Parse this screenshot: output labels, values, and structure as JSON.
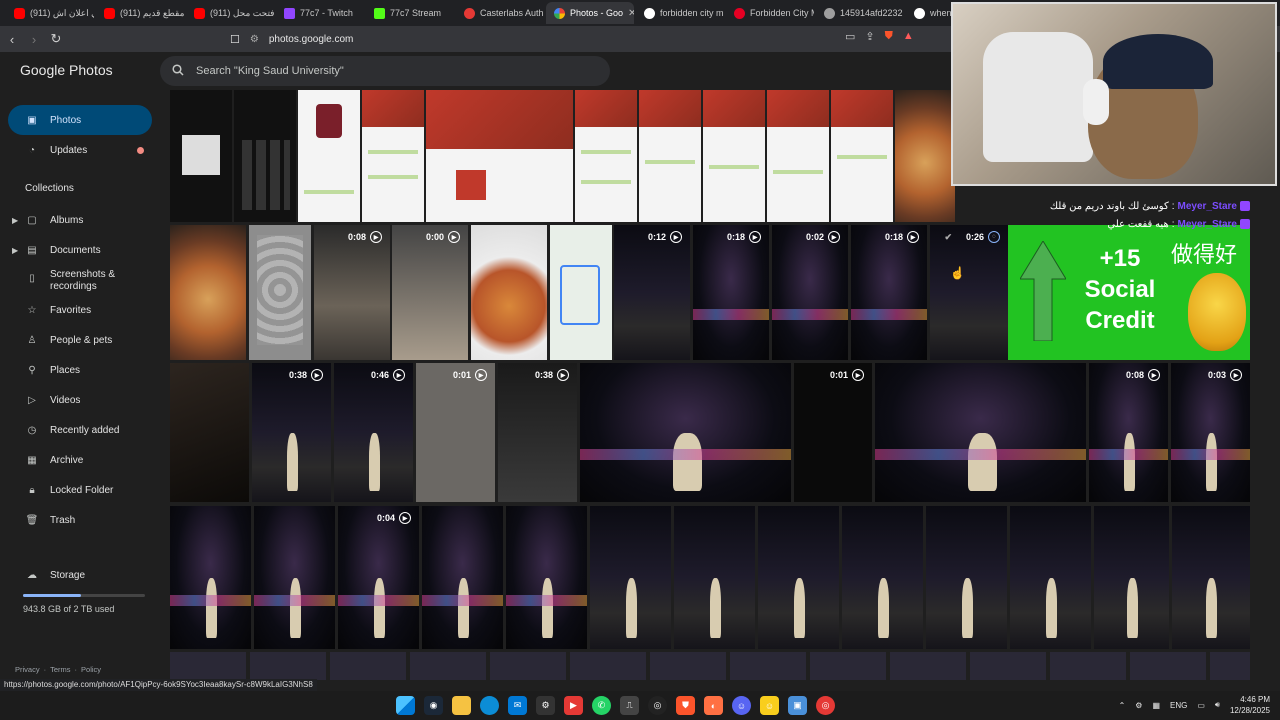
{
  "browser": {
    "tabs": [
      {
        "label": "(911) اي اعلان اش",
        "color": "#ff0000"
      },
      {
        "label": "(911) مقطع قديم",
        "color": "#ff0000"
      },
      {
        "label": "(911) فتحت محل",
        "color": "#ff0000"
      },
      {
        "label": "77c7 - Twitch",
        "color": "#9146ff"
      },
      {
        "label": "77c7 Stream",
        "color": "#53fc18"
      },
      {
        "label": "Casterlabs Auth",
        "color": "#e53935"
      },
      {
        "label": "Photos - Goo",
        "color": "#fbbc04",
        "active": true
      },
      {
        "label": "forbidden city m",
        "color": "#ffffff"
      },
      {
        "label": "Forbidden City M",
        "color": "#e60023"
      },
      {
        "label": "145914afd2232",
        "color": "#9e9e9e"
      },
      {
        "label": "when did the",
        "color": "#ffffff"
      }
    ],
    "url": "photos.google.com",
    "status_url": "https://photos.google.com/photo/AF1QipPcy-6ok9SYoc3Ieaa8kaySr-c8W9kLaIG3NhS8"
  },
  "app": {
    "logo_google": "Google",
    "logo_photos": "Photos",
    "search_placeholder": "Search \"King Saud University\""
  },
  "sidebar": {
    "primary": [
      {
        "label": "Photos",
        "icon": "photo-icon"
      },
      {
        "label": "Updates",
        "icon": "updates-icon"
      }
    ],
    "collections_title": "Collections",
    "collections": [
      {
        "label": "Albums",
        "icon": "album-icon",
        "expand": true
      },
      {
        "label": "Documents",
        "icon": "document-icon",
        "expand": true
      },
      {
        "label": "Screenshots &",
        "label2": "recordings",
        "icon": "screenshot-icon"
      },
      {
        "label": "Favorites",
        "icon": "star-icon"
      },
      {
        "label": "People & pets",
        "icon": "person-icon"
      },
      {
        "label": "Places",
        "icon": "place-icon"
      },
      {
        "label": "Videos",
        "icon": "video-icon"
      },
      {
        "label": "Recently added",
        "icon": "history-icon"
      },
      {
        "label": "Archive",
        "icon": "archive-icon"
      },
      {
        "label": "Locked Folder",
        "icon": "lock-icon"
      },
      {
        "label": "Trash",
        "icon": "trash-icon"
      }
    ],
    "storage_label": "Storage",
    "storage_text": "943.8 GB of 2 TB used",
    "storage_fraction": 0.4719,
    "footer": [
      "Privacy",
      "·",
      "Terms",
      "·",
      "Policy"
    ]
  },
  "videos": {
    "r2": [
      "0:08",
      "0:00",
      "0:12",
      "0:18",
      "0:02",
      "0:18",
      "0:26"
    ],
    "r3": [
      "0:38",
      "0:46",
      "0:01",
      "0:38",
      "0:01",
      "0:08",
      "0:03"
    ],
    "r4": [
      "0:04"
    ]
  },
  "overlay": {
    "credit_line1": "+15",
    "credit_line2": "Social",
    "credit_line3": "Credit",
    "credit_cn": "做得好",
    "chat": [
      {
        "name": "Meyer_Stare",
        "text": "كوسئ لك باوند دريم من قلك"
      },
      {
        "name": "Meyer_Stare",
        "text": "هيه قفعت علي"
      }
    ]
  },
  "taskbar": {
    "lang": "ENG",
    "time": "4:46 PM",
    "date": "12/28/2025"
  }
}
